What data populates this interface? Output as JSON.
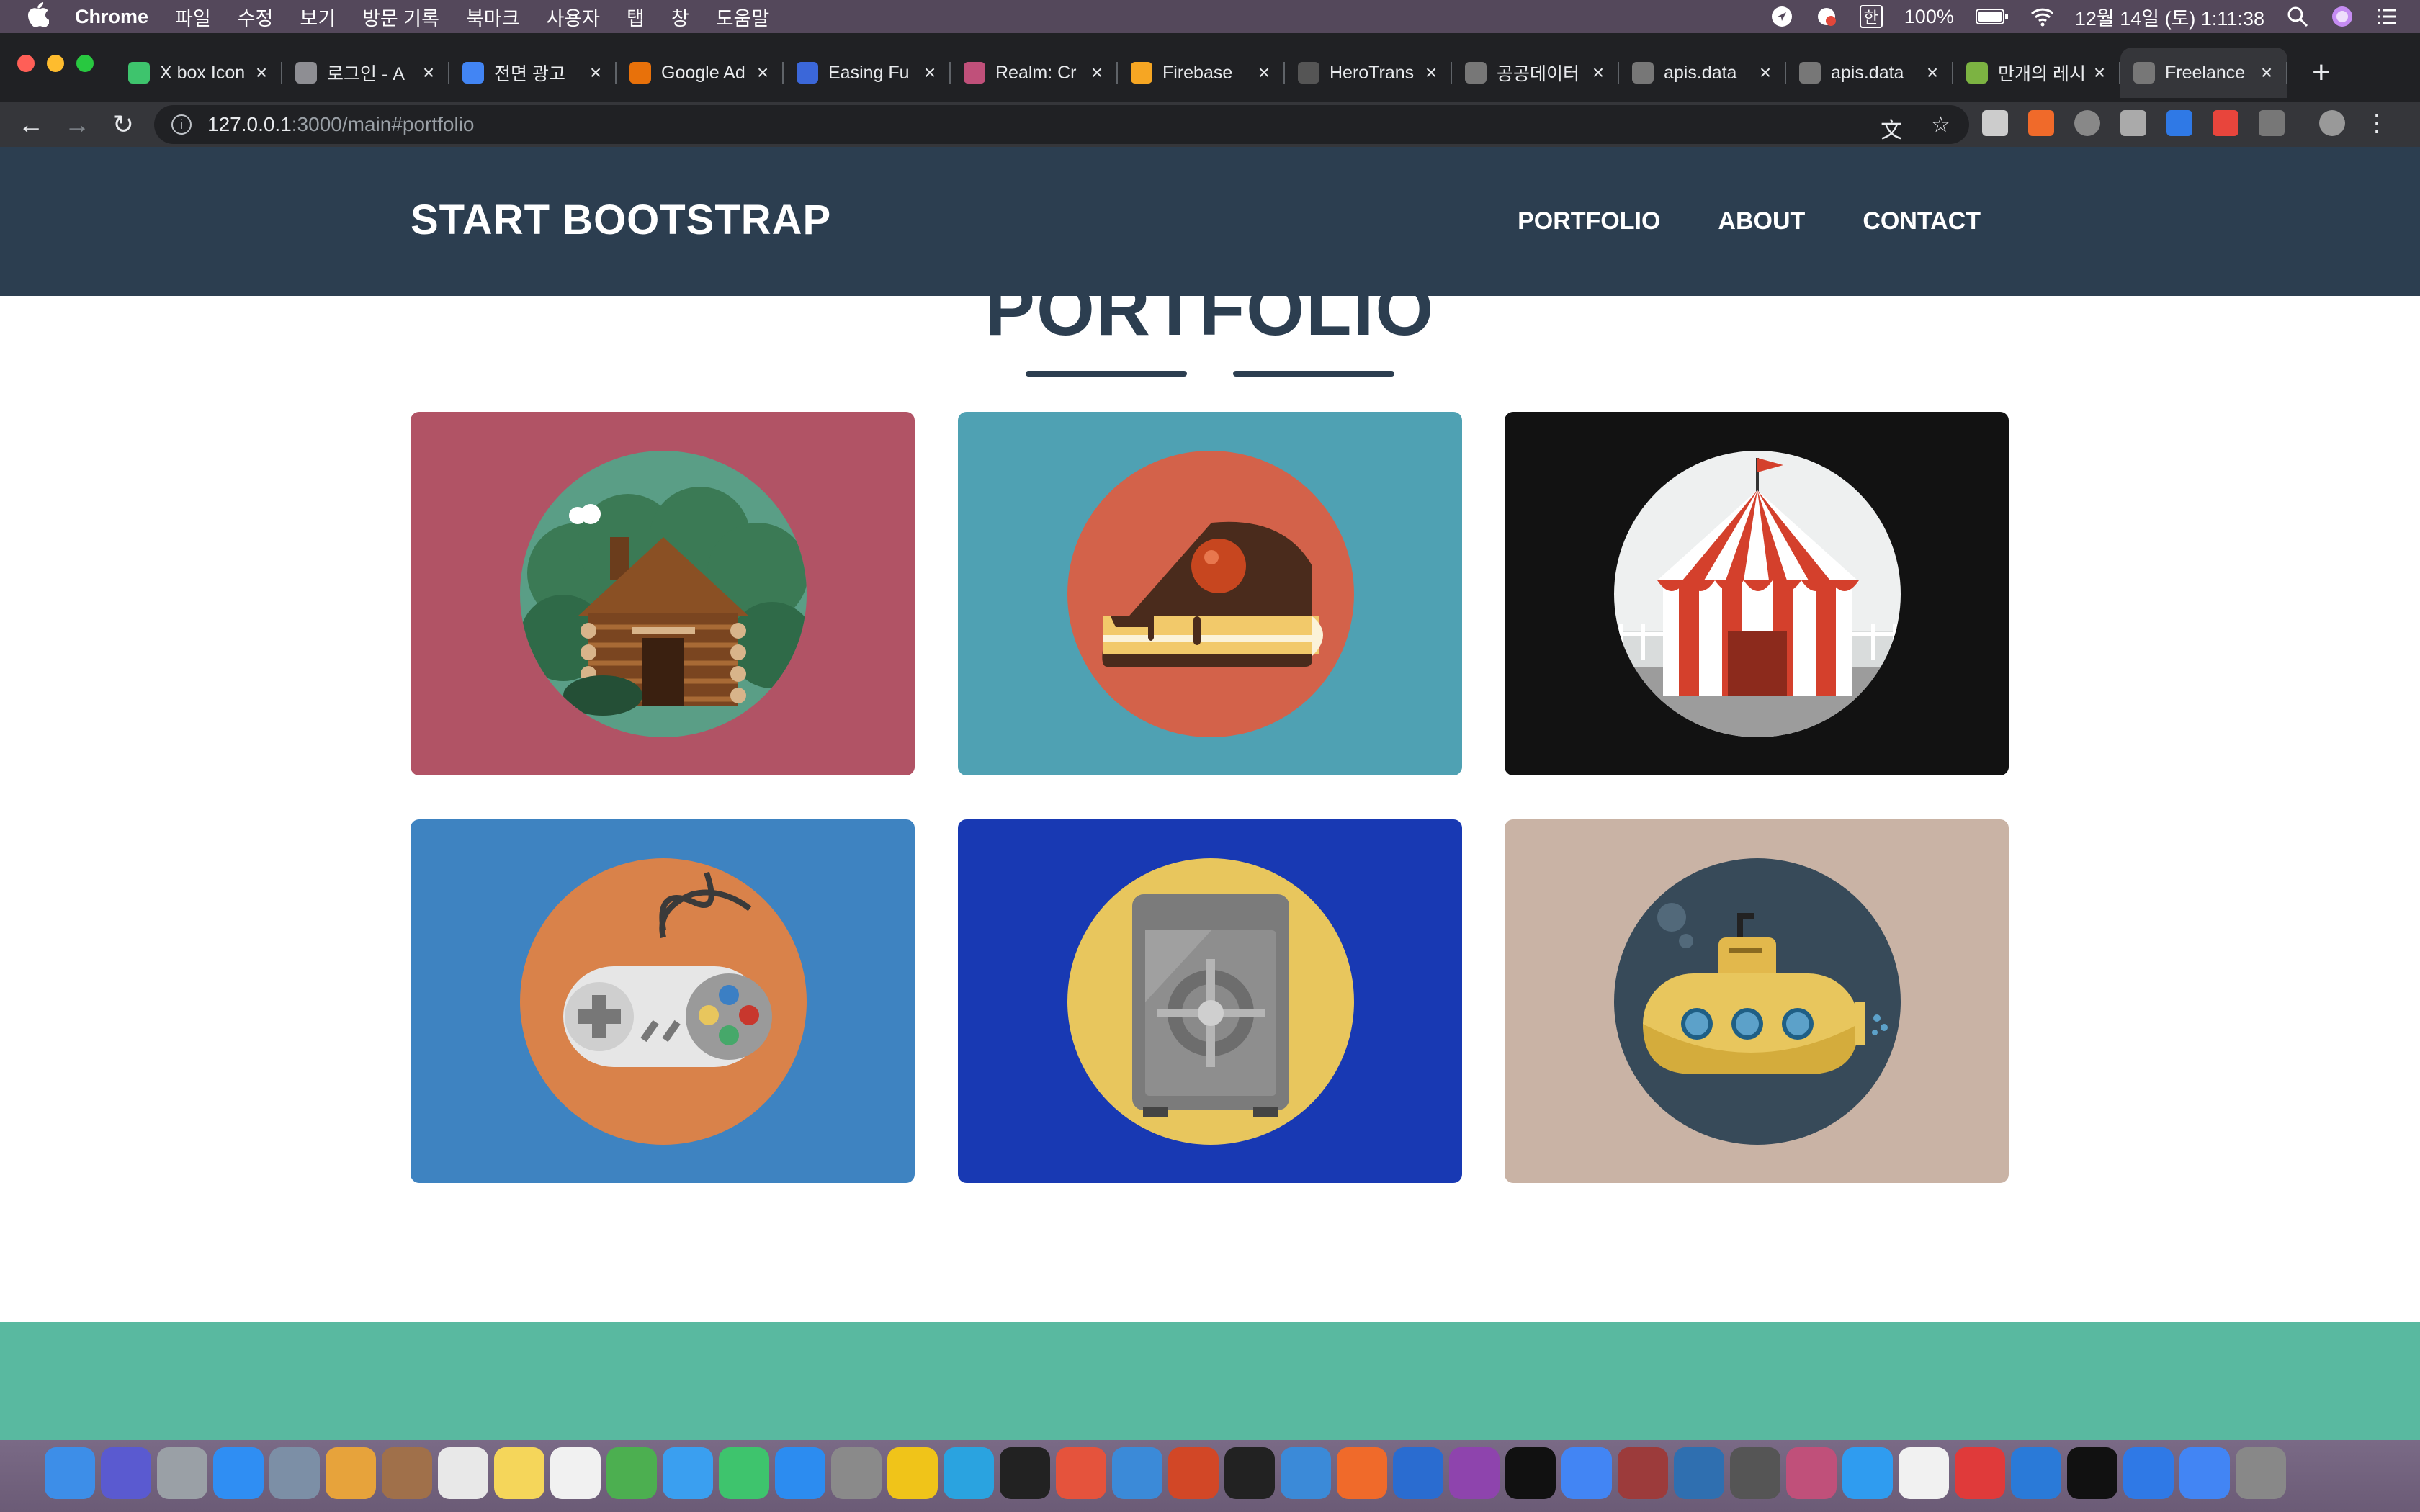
{
  "menubar": {
    "app": "Chrome",
    "items": [
      "파일",
      "수정",
      "보기",
      "방문 기록",
      "북마크",
      "사용자",
      "탭",
      "창",
      "도움말"
    ],
    "ime": "한",
    "battery": "100%",
    "datetime": "12월 14일 (토)  1:11:38"
  },
  "tabs": [
    {
      "title": "X box Icon",
      "color": "#3ec46d"
    },
    {
      "title": "로그인 - A",
      "color": "#8e8e93"
    },
    {
      "title": "전면 광고",
      "color": "#4285f4"
    },
    {
      "title": "Google Ad",
      "color": "#e8710a"
    },
    {
      "title": "Easing Fu",
      "color": "#3b67d9"
    },
    {
      "title": "Realm: Cr",
      "color": "#c0507a"
    },
    {
      "title": "Firebase",
      "color": "#f6a623"
    },
    {
      "title": "HeroTrans",
      "color": "#555555"
    },
    {
      "title": "공공데이터",
      "color": "#777777"
    },
    {
      "title": "apis.data",
      "color": "#777777"
    },
    {
      "title": "apis.data",
      "color": "#777777"
    },
    {
      "title": "만개의 레시",
      "color": "#7cb342"
    },
    {
      "title": "Freelance",
      "color": "#777777",
      "active": true
    }
  ],
  "address": {
    "host": "127.0.0.1",
    "path": ":3000/main#portfolio"
  },
  "site": {
    "brand": "START BOOTSTRAP",
    "nav": [
      "PORTFOLIO",
      "ABOUT",
      "CONTACT"
    ],
    "section_title": "PORTFOLIO",
    "items": [
      {
        "name": "cabin",
        "bg": "#b15365",
        "circle": "#5a9e86"
      },
      {
        "name": "cake",
        "bg": "#4fa1b3",
        "circle": "#d3624a"
      },
      {
        "name": "circus",
        "bg": "#121212",
        "circle": "#eef0f0"
      },
      {
        "name": "game",
        "bg": "#3e83c1",
        "circle": "#d9824a"
      },
      {
        "name": "safe",
        "bg": "#1839b3",
        "circle": "#e8c65d"
      },
      {
        "name": "submarine",
        "bg": "#c9b3a5",
        "circle": "#374a59"
      }
    ]
  },
  "colors": {
    "navbar": "#2c3e50",
    "footer": "#59b9a0"
  }
}
